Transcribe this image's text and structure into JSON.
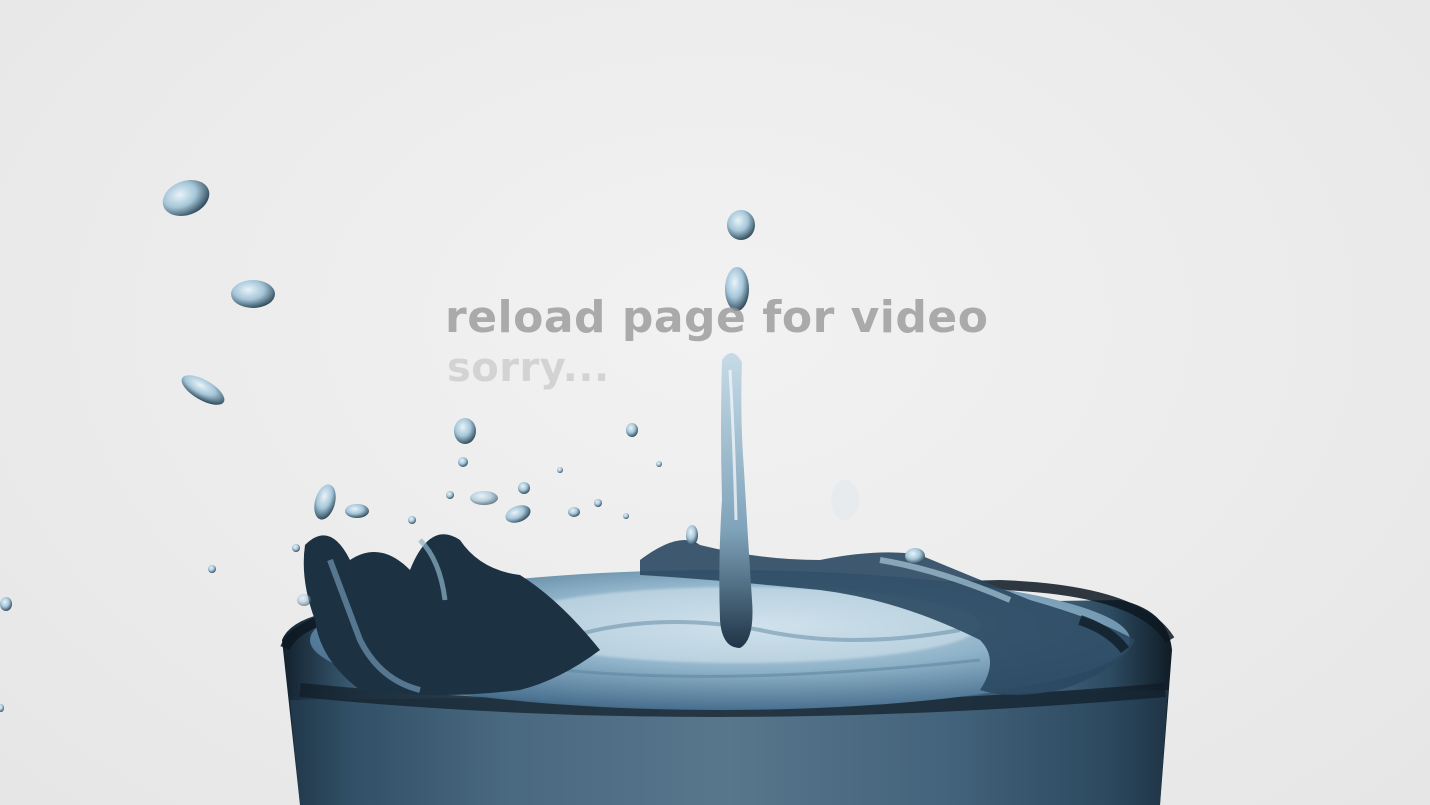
{
  "message": {
    "line1": "reload page for video",
    "line2": "sorry..."
  },
  "colors": {
    "background": "#ececec",
    "water_dark": "#1f3447",
    "water_mid": "#4e7a99",
    "water_light": "#b8d2e2",
    "text_primary": "#969696",
    "text_secondary": "#c8c8c8"
  },
  "media": {
    "kind": "video-fallback-still",
    "subject": "water-splash-in-glass"
  }
}
